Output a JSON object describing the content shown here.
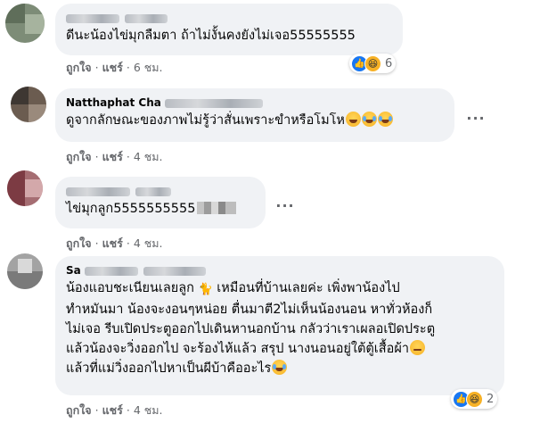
{
  "comments": [
    {
      "author": "",
      "text": "ดีนะน้องไข่มุกลืมตา ถ้าไม่งั้นคงยังไม่เจอ55555555",
      "actions": {
        "like": "ถูกใจ",
        "share": "แชร์",
        "time": "6 ชม."
      },
      "reactions": {
        "types": [
          "like-icon",
          "haha-icon"
        ],
        "count": "6"
      }
    },
    {
      "author": "Natthaphat Cha",
      "text": "ดูจากลักษณะของภาพไม่รู้ว่าสั่นเพราะขำหรือโมโห",
      "actions": {
        "like": "ถูกใจ",
        "share": "แชร์",
        "time": "4 ชม."
      }
    },
    {
      "author": "",
      "text": "ไข่มุกลูก5555555555",
      "actions": {
        "like": "ถูกใจ",
        "share": "แชร์",
        "time": "4 ชม."
      }
    },
    {
      "author": "Sa",
      "text_lines": [
        "น้องแอบชะเนียนเลยลูก",
        "เหมือนที่บ้านเลยค่ะ เพิ่งพาน้องไป",
        "ทำหมันมา น้องจะงอนๆหน่อย ตื่นมาตี2ไม่เห็นน้องนอน หาทั่วห้องก็",
        "ไม่เจอ รีบเปิดประตูออกไปเดินหานอกบ้าน กลัวว่าเราเผลอเปิดประตู",
        "แล้วน้องจะวิ่งออกไป จะร้องไห้แล้ว สรุป นางนอนอยู่ใต้ตู้เสื้อผ้า",
        "แล้วที่แม่วิ่งออกไปหาเป็นผีบ้าคืออะไร"
      ],
      "actions": {
        "like": "ถูกใจ",
        "share": "แชร์",
        "time": "4 ชม."
      },
      "reactions": {
        "types": [
          "like-icon",
          "haha-icon"
        ],
        "count": "2"
      }
    }
  ],
  "colors": {
    "bubble": "#f0f2f5",
    "meta": "#65676b",
    "like": "#1877f2",
    "haha": "#f7b125"
  }
}
